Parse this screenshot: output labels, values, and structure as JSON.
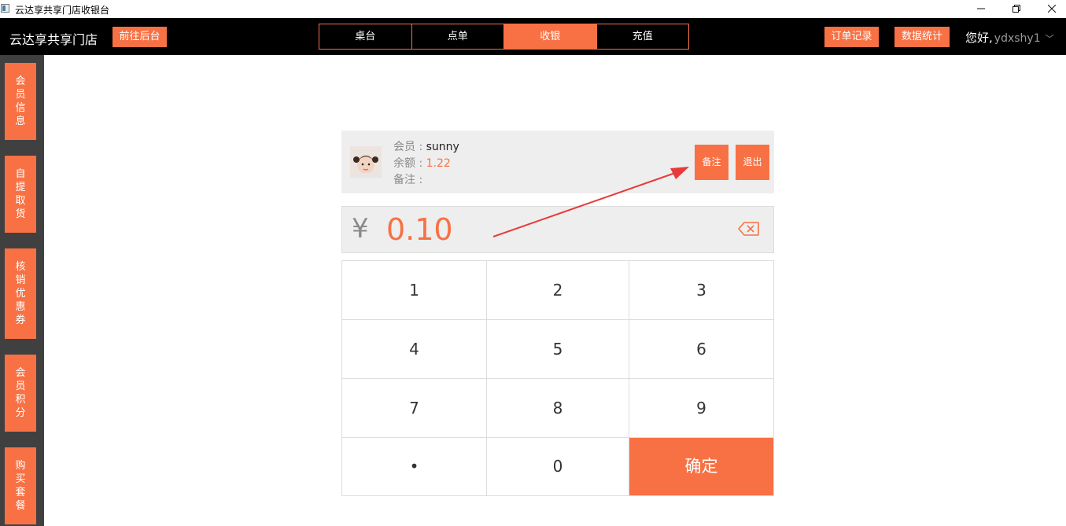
{
  "window": {
    "title": "云达享共享门店收银台",
    "icons": [
      "app-icon",
      "minimize-icon",
      "restore-icon",
      "close-icon"
    ]
  },
  "topbar": {
    "store_name": "云达享共享门店",
    "backend_button": "前往后台",
    "tabs": [
      {
        "label": "桌台",
        "active": false
      },
      {
        "label": "点单",
        "active": false
      },
      {
        "label": "收银",
        "active": true
      },
      {
        "label": "充值",
        "active": false
      }
    ],
    "order_records": "订单记录",
    "data_stats": "数据统计",
    "greeting": "您好,",
    "username": "ydxshy1",
    "user_menu_icon": "chevron-down-icon"
  },
  "sidebar": {
    "items": [
      {
        "label": "会员信息"
      },
      {
        "label": "自提取货"
      },
      {
        "label": "核销优惠券"
      },
      {
        "label": "会员积分"
      },
      {
        "label": "购买套餐"
      }
    ]
  },
  "member": {
    "member_label": "会员 : ",
    "member_name": "sunny",
    "balance_label": "余额 : ",
    "balance": "1.22",
    "note_label": "备注 : ",
    "note_button": "备注",
    "exit_button": "退出"
  },
  "amount": {
    "currency": "¥",
    "value": "0.10",
    "backspace_icon": "backspace-icon"
  },
  "keypad": {
    "keys": [
      "1",
      "2",
      "3",
      "4",
      "5",
      "6",
      "7",
      "8",
      "9",
      "•",
      "0"
    ],
    "confirm": "确定"
  },
  "colors": {
    "accent": "#f87144",
    "topbar": "#000000",
    "sidebar": "#404040",
    "panel": "#eeeeee",
    "annotation_arrow": "#e83a3a"
  }
}
